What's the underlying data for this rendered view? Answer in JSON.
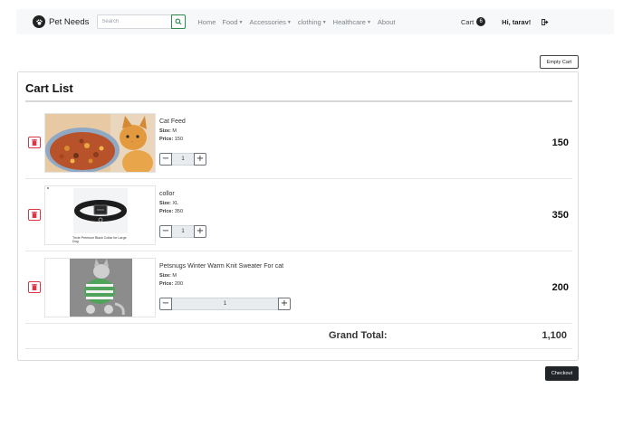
{
  "brand": {
    "name": "Pet Needs",
    "logo_icon": "paw-icon"
  },
  "search": {
    "placeholder": "Search",
    "button_icon": "search-icon"
  },
  "nav": {
    "home": "Home",
    "food": "Food",
    "accessories": "Accessories",
    "clothing": "clothing",
    "healthcare": "Healthcare",
    "about": "About",
    "cart_label": "Cart",
    "cart_count": "6",
    "greeting": "Hi, tarav!",
    "logout_icon": "logout-icon"
  },
  "cart": {
    "empty_button": "Empty Cart",
    "title": "Cart List",
    "size_label": "Size:",
    "price_label": "Price:",
    "items": [
      {
        "name": "Cat Feed",
        "size": "M",
        "price": "150",
        "quantity": "1",
        "total": "150",
        "image": "cat with food bowl"
      },
      {
        "name": "collor",
        "size": "XL",
        "price": "350",
        "quantity": "1",
        "total": "350",
        "image": "black dog collar",
        "image_caption": "Trixie Premium Black Collar for Large Dog"
      },
      {
        "name": "Petsnugs Winter Warm Knit Sweater For cat",
        "size": "M",
        "price": "200",
        "quantity": "1",
        "total": "200",
        "image": "cat in green striped sweater"
      }
    ],
    "grand_total_label": "Grand Total:",
    "grand_total_value": "1,100",
    "checkout_button": "Checkout"
  },
  "colors": {
    "success": "#2f8a4e",
    "danger": "#dc3545",
    "dark": "#212529",
    "navbar_bg": "#f7f8f9"
  }
}
